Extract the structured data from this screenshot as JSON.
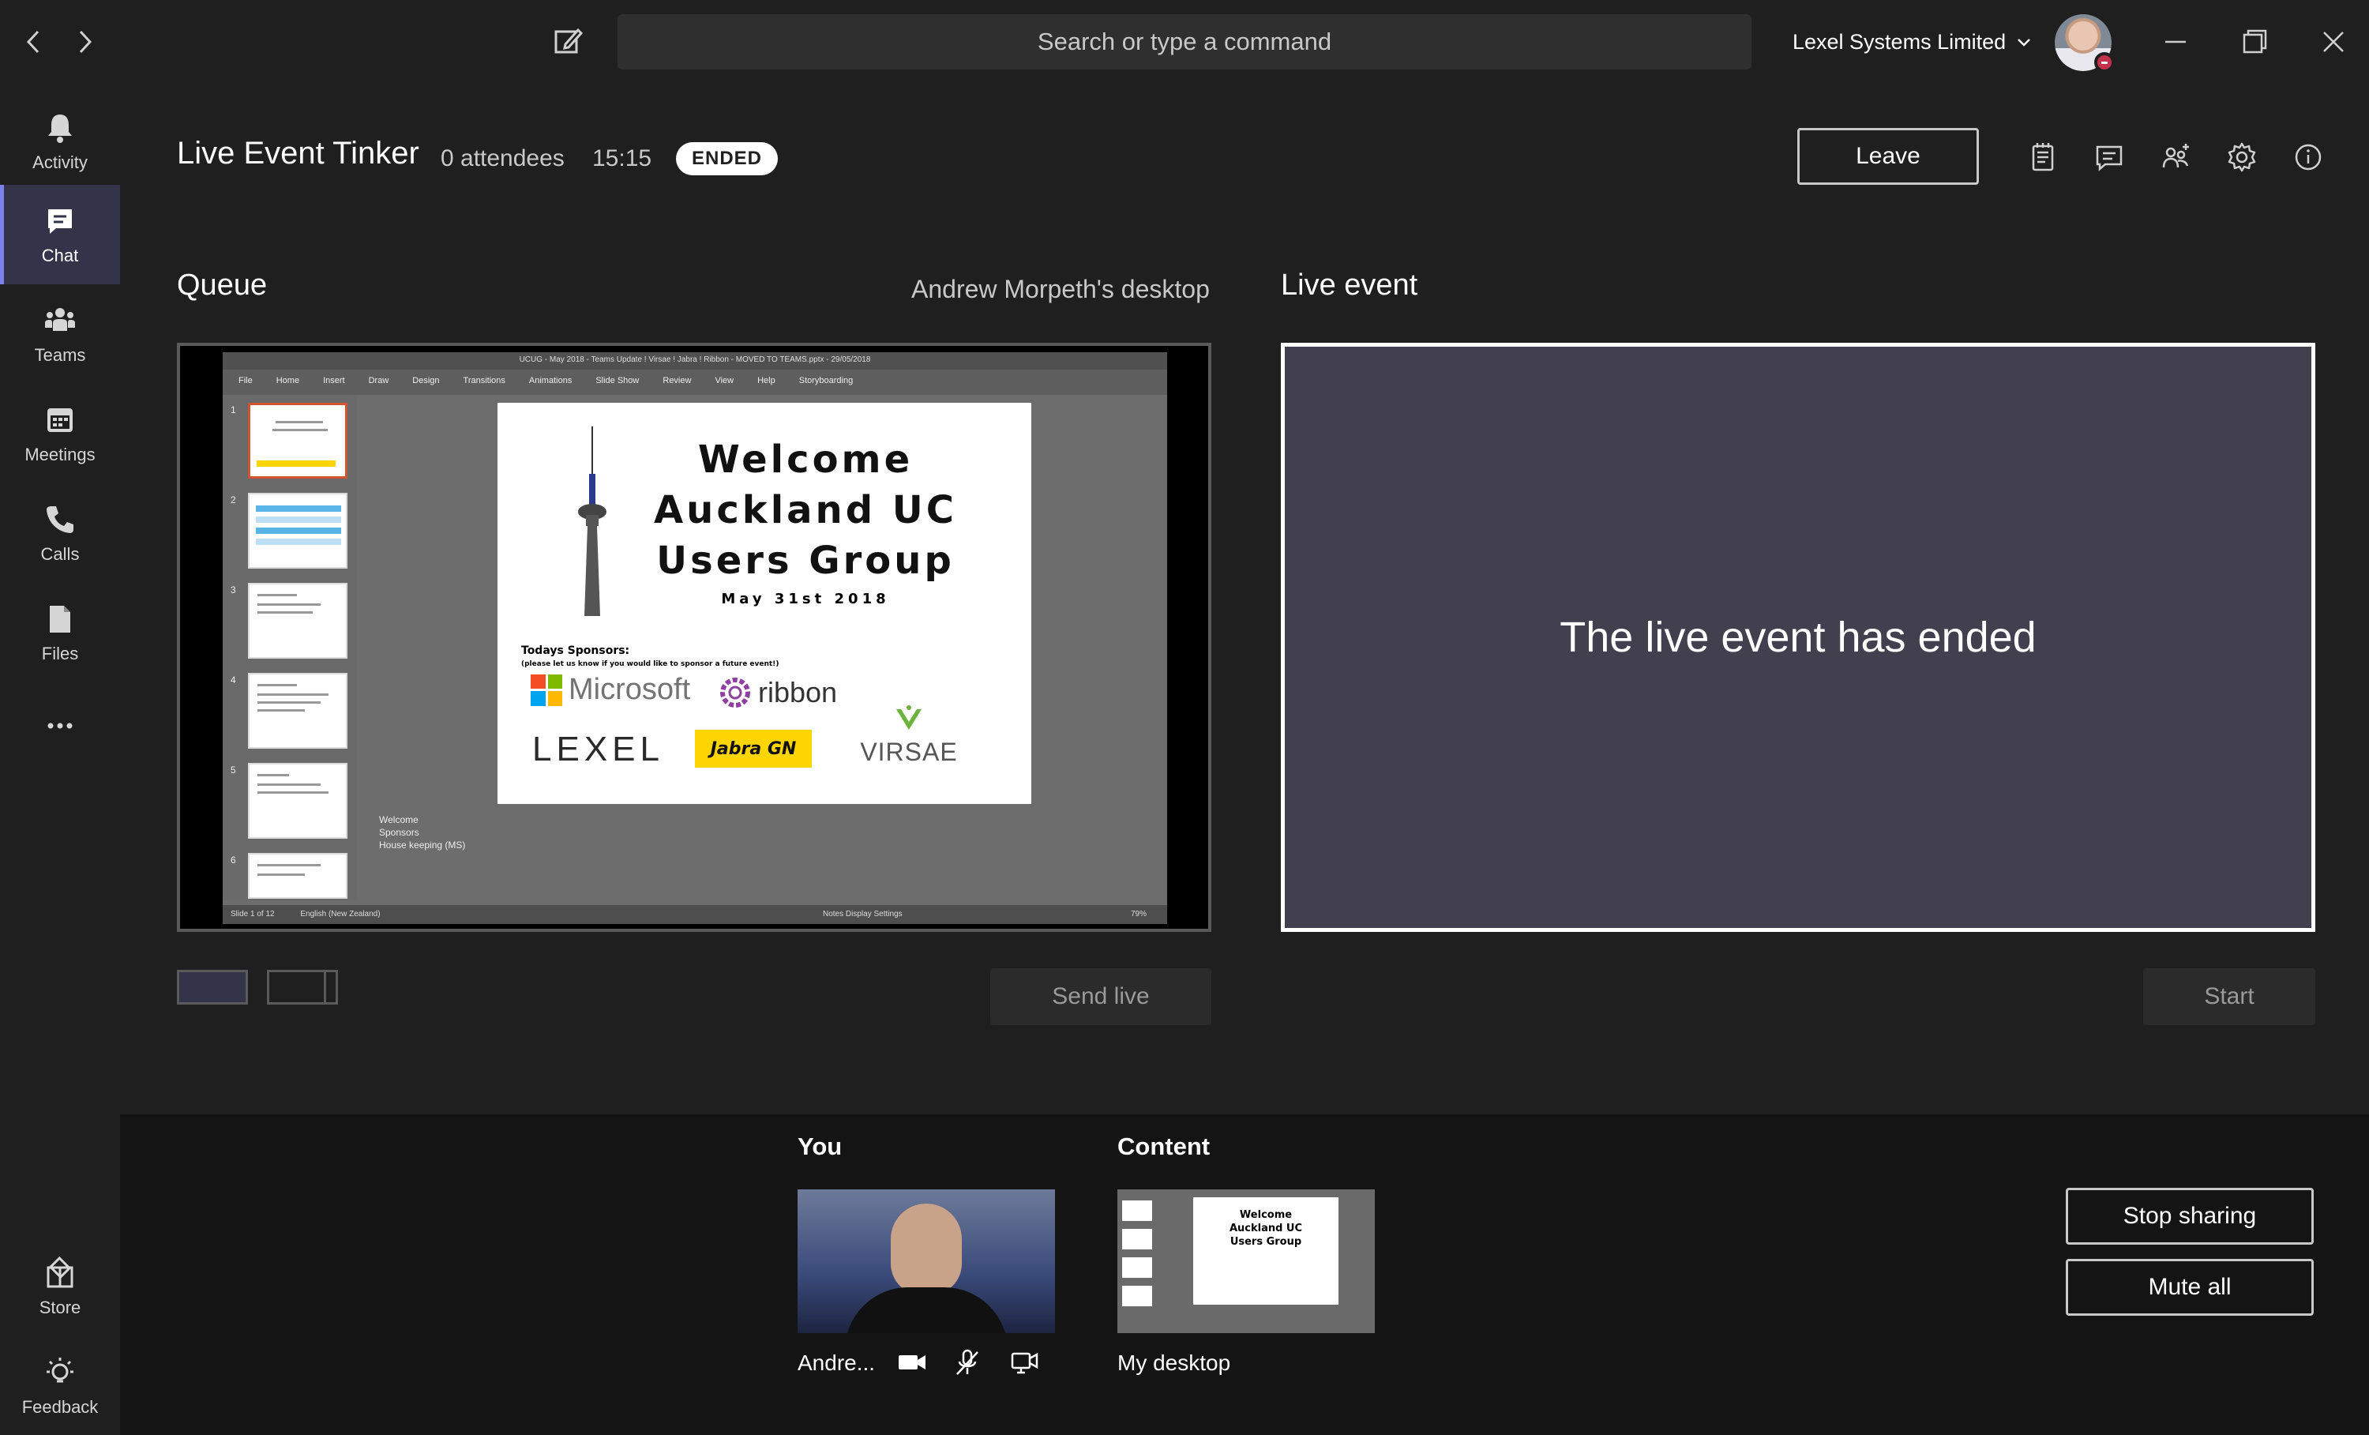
{
  "titlebar": {
    "search_placeholder": "Search or type a command",
    "org_name": "Lexel Systems Limited"
  },
  "rail": {
    "items": [
      {
        "label": "Activity",
        "icon": "bell-icon"
      },
      {
        "label": "Chat",
        "icon": "chat-icon",
        "active": true
      },
      {
        "label": "Teams",
        "icon": "teams-icon"
      },
      {
        "label": "Meetings",
        "icon": "calendar-icon"
      },
      {
        "label": "Calls",
        "icon": "phone-icon"
      },
      {
        "label": "Files",
        "icon": "file-icon"
      }
    ],
    "store_label": "Store",
    "feedback_label": "Feedback"
  },
  "event": {
    "title": "Live Event Tinker",
    "attendees": "0 attendees",
    "duration": "15:15",
    "status": "ENDED",
    "leave_label": "Leave"
  },
  "queue": {
    "label": "Queue",
    "source": "Andrew Morpeth's desktop",
    "send_live_label": "Send live"
  },
  "live": {
    "label": "Live event",
    "message": "The live event has ended",
    "start_label": "Start"
  },
  "slide": {
    "title_lines": [
      "Welcome",
      "Auckland UC",
      "Users Group"
    ],
    "date": "May 31st 2018",
    "sponsors_title": "Todays Sponsors:",
    "sponsors_sub": "(please let us know if you would like to sponsor a future event!)",
    "logos": {
      "microsoft": "Microsoft",
      "ribbon": "ribbon",
      "lexel": "LEXEL",
      "jabra": "Jabra GN",
      "virsae": "VIRSAE"
    },
    "notes": [
      "Welcome",
      "Sponsors",
      "House keeping (MS)"
    ],
    "ribbon_tabs": [
      "File",
      "Home",
      "Insert",
      "Draw",
      "Design",
      "Transitions",
      "Animations",
      "Slide Show",
      "Review",
      "View",
      "Help",
      "Storyboarding"
    ],
    "window_title": "UCUG - May 2018 - Teams Update ! Virsae ! Jabra ! Ribbon - MOVED TO TEAMS.pptx - 29/05/2018",
    "status_left": "Slide 1 of 12",
    "status_lang": "English (New Zealand)",
    "status_right": "Notes   Display Settings",
    "zoom": "79%",
    "thumb_numbers": [
      "1",
      "2",
      "3",
      "4",
      "5",
      "6"
    ]
  },
  "tray": {
    "you_label": "You",
    "you_name": "Andre...",
    "content_label": "Content",
    "content_name": "My desktop",
    "stop_sharing_label": "Stop sharing",
    "mute_all_label": "Mute all"
  }
}
